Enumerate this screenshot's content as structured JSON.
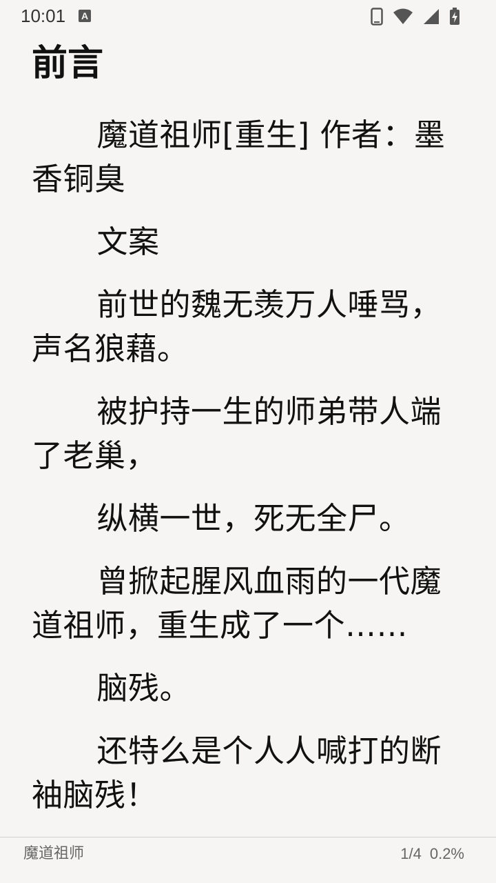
{
  "status_bar": {
    "time": "10:01",
    "icons": [
      "a-notification-icon",
      "phone-icon",
      "wifi-icon",
      "signal-icon",
      "battery-charging-icon"
    ]
  },
  "chapter": {
    "title": "前言"
  },
  "paragraphs": [
    "魔道祖师[重生] 作者：墨香铜臭",
    "文案",
    "前世的魏无羡万人唾骂，声名狼藉。",
    "被护持一生的师弟带人端了老巢，",
    "纵横一世，死无全尸。",
    "曾掀起腥风血雨的一代魔道祖师，重生成了一个……",
    "脑残。",
    "还特么是个人人喊打的断袖脑残！"
  ],
  "footer": {
    "book_title": "魔道祖师",
    "page": "1/4",
    "percent": "0.2%"
  },
  "colors": {
    "background": "#f6f5f3",
    "text": "#111111",
    "footer_text": "#666666",
    "status_icons": "#555555"
  }
}
